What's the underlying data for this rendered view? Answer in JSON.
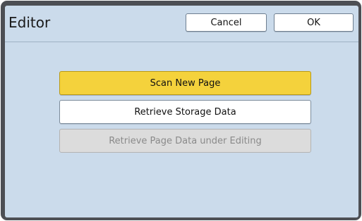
{
  "header": {
    "title": "Editor",
    "cancel_label": "Cancel",
    "ok_label": "OK"
  },
  "actions": {
    "scan_new_page": "Scan New Page",
    "retrieve_storage_data": "Retrieve Storage Data",
    "retrieve_page_data_editing": "Retrieve Page Data under Editing"
  },
  "colors": {
    "panel_background": "#cbdbeb",
    "frame": "#4d4f54",
    "primary_button": "#f4d23c",
    "disabled_button": "#dcdcdc"
  }
}
